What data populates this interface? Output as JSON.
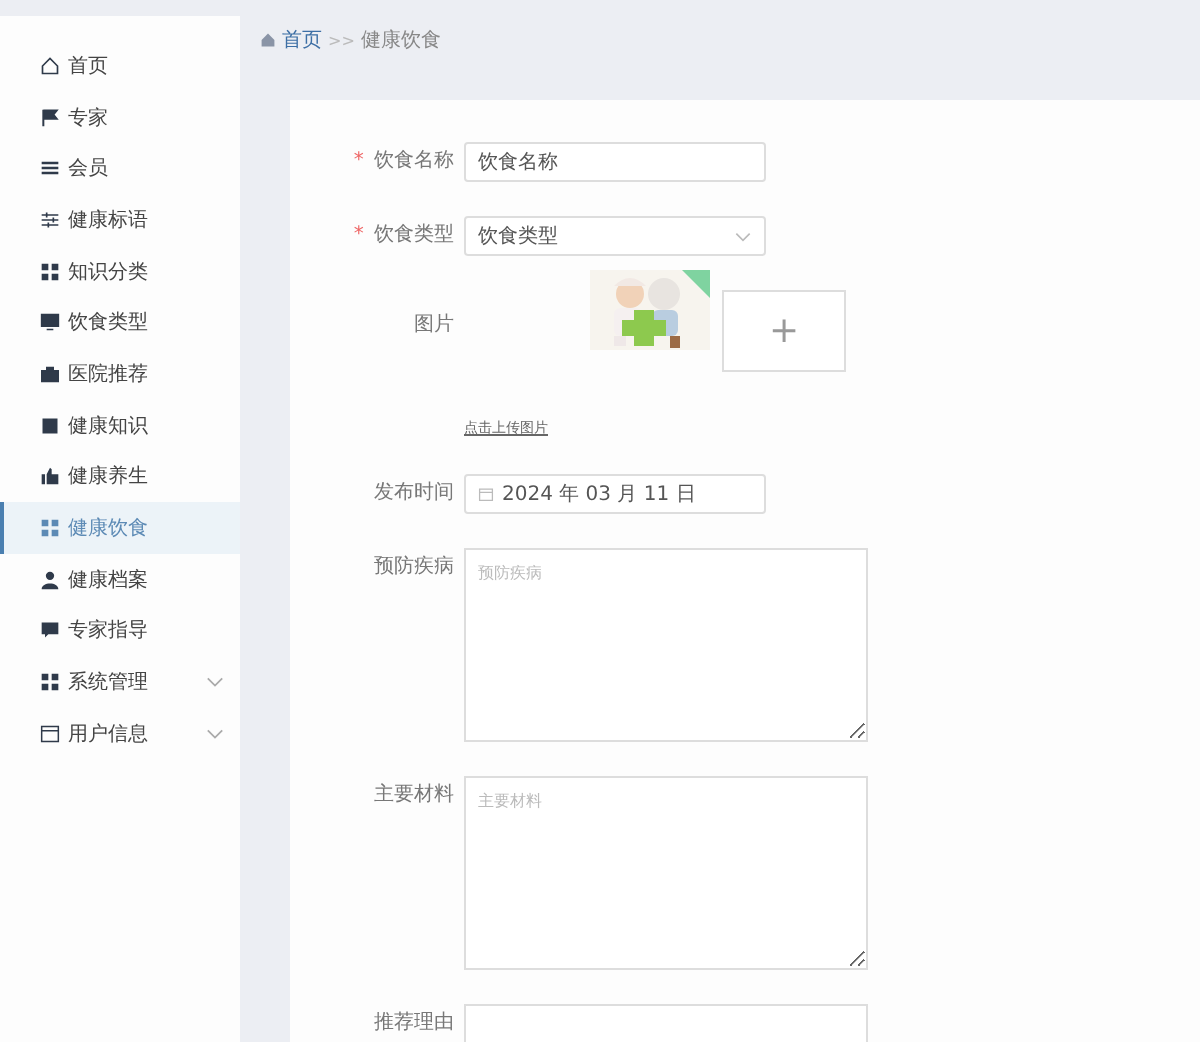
{
  "sidebar": {
    "items": [
      {
        "label": "首页",
        "kind": "link",
        "selected": false
      },
      {
        "label": "专家",
        "kind": "link",
        "selected": false
      },
      {
        "label": "会员",
        "kind": "link",
        "selected": false
      },
      {
        "label": "健康标语",
        "kind": "link",
        "selected": false
      },
      {
        "label": "知识分类",
        "kind": "link",
        "selected": false
      },
      {
        "label": "饮食类型",
        "kind": "link",
        "selected": false
      },
      {
        "label": "医院推荐",
        "kind": "link",
        "selected": false
      },
      {
        "label": "健康知识",
        "kind": "link",
        "selected": false
      },
      {
        "label": "健康养生",
        "kind": "link",
        "selected": false
      },
      {
        "label": "健康饮食",
        "kind": "link",
        "selected": true
      },
      {
        "label": "健康档案",
        "kind": "link",
        "selected": false
      },
      {
        "label": "专家指导",
        "kind": "link",
        "selected": false
      },
      {
        "label": "系统管理",
        "kind": "group",
        "expanded": false,
        "selected": false
      },
      {
        "label": "用户信息",
        "kind": "group",
        "expanded": false,
        "selected": false
      }
    ]
  },
  "breadcrumb": {
    "home": "首页",
    "separator": ">>",
    "current": "健康饮食"
  },
  "form": {
    "fields": [
      {
        "kind": "input",
        "required_mark": "*",
        "label": "饮食名称",
        "value": "饮食名称"
      },
      {
        "kind": "select",
        "required_mark": "*",
        "label": "饮食类型",
        "value": "饮食类型"
      },
      {
        "label": "图片",
        "upload_symbol": "+",
        "hint": "点击上传图片"
      },
      {
        "kind": "date",
        "label": "发布时间",
        "value": "2024 年 03 月 11 日"
      },
      {
        "kind": "textarea",
        "label": "预防疾病",
        "placeholder": "预防疾病"
      },
      {
        "kind": "textarea",
        "label": "主要材料",
        "placeholder": "主要材料"
      },
      {
        "kind": "textarea",
        "label": "推荐理由"
      }
    ]
  }
}
